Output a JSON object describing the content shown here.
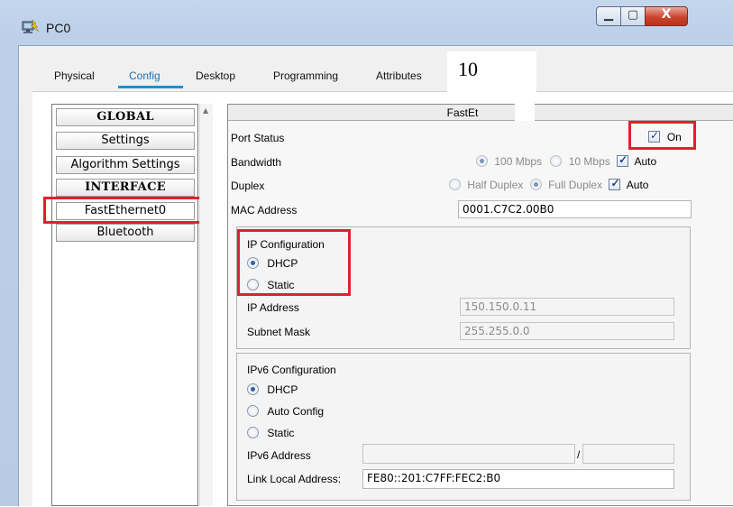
{
  "window": {
    "title": "PC0"
  },
  "window_controls": {
    "minimize": "▁",
    "maximize": "▢",
    "close": "X"
  },
  "tabs": {
    "physical": "Physical",
    "config": "Config",
    "desktop": "Desktop",
    "programming": "Programming",
    "attributes": "Attributes",
    "overlay_number": "10"
  },
  "sidebar": {
    "global": "GLOBAL",
    "settings": "Settings",
    "algorithm_settings": "Algorithm Settings",
    "interface": "INTERFACE",
    "fastethernet0": "FastEthernet0",
    "bluetooth": "Bluetooth"
  },
  "panel": {
    "title": "FastEt",
    "port_status": {
      "label": "Port Status",
      "on_label": "On",
      "checked": true
    },
    "bandwidth": {
      "label": "Bandwidth",
      "opt1": "100 Mbps",
      "opt2": "10 Mbps",
      "auto": "Auto"
    },
    "duplex": {
      "label": "Duplex",
      "opt1": "Half Duplex",
      "opt2": "Full Duplex",
      "auto": "Auto"
    },
    "mac": {
      "label": "MAC Address",
      "value": "0001.C7C2.00B0"
    },
    "ipv4": {
      "heading": "IP Configuration",
      "dhcp": "DHCP",
      "static": "Static",
      "ip_label": "IP Address",
      "ip_value": "150.150.0.11",
      "mask_label": "Subnet Mask",
      "mask_value": "255.255.0.0"
    },
    "ipv6": {
      "heading": "IPv6 Configuration",
      "dhcp": "DHCP",
      "auto_config": "Auto Config",
      "static": "Static",
      "addr_label": "IPv6 Address",
      "addr_value": "",
      "prefix_sep": "/",
      "prefix_value": "",
      "link_local_label": "Link Local Address:",
      "link_local_value": "FE80::201:C7FF:FEC2:B0"
    }
  },
  "colors": {
    "highlight_red": "#e0202e",
    "tab_blue": "#1f8fd6"
  }
}
